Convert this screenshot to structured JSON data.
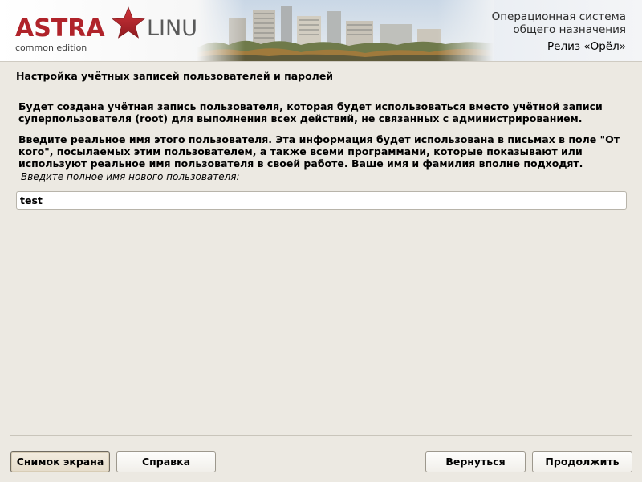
{
  "header": {
    "logo": {
      "astra": "ASTRA",
      "linux": "LINUX",
      "edition": "common edition",
      "brand_color": "#b0232a"
    },
    "os_line1": "Операционная система",
    "os_line2": "общего назначения",
    "release": "Релиз «Орёл»"
  },
  "main": {
    "title": "Настройка учётных записей пользователей и паролей",
    "paragraph1": "Будет создана учётная запись пользователя, которая будет использоваться вместо учётной записи суперпользователя (root) для выполнения всех действий, не связанных с администрированием.",
    "paragraph2": "Введите реальное имя этого пользователя. Эта информация будет использована в письмах в поле \"От кого\", посылаемых этим пользователем, а также всеми программами, которые показывают или используют реальное имя пользователя в своей работе. Ваше имя и фамилия вполне подходят.",
    "fullname_field": {
      "label": "Введите полное имя нового пользователя:",
      "value": "test"
    }
  },
  "footer": {
    "screenshot_label": "Снимок экрана",
    "help_label": "Справка",
    "back_label": "Вернуться",
    "continue_label": "Продолжить"
  }
}
